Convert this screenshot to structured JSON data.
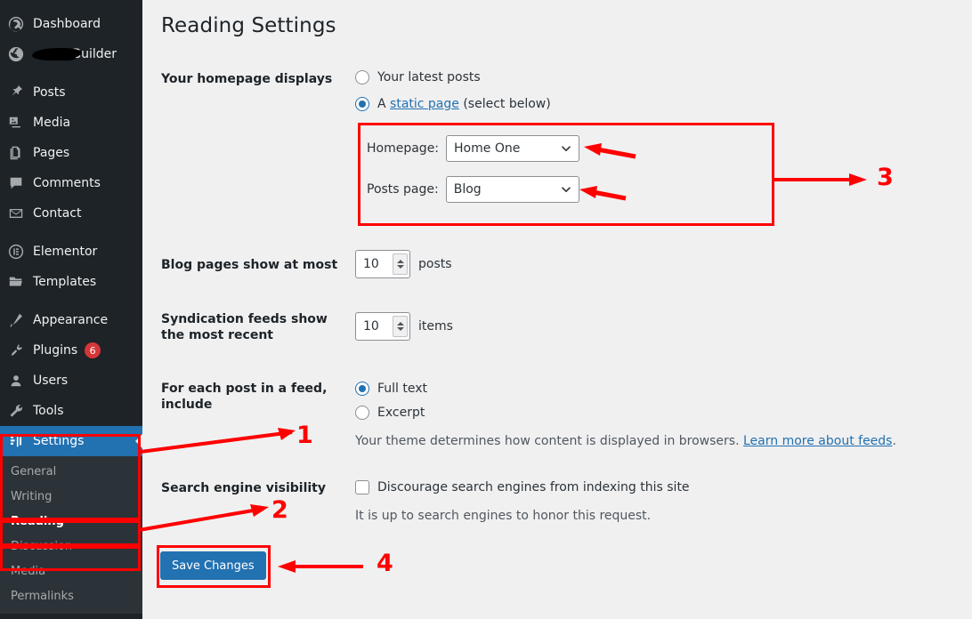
{
  "sidebar": {
    "items": [
      {
        "label": "Dashboard",
        "icon": "dashboard-icon",
        "badge": null,
        "redacted": false
      },
      {
        "label": "u Builder",
        "icon": "globe-icon",
        "badge": null,
        "redacted": true
      },
      {
        "label": "Posts",
        "icon": "pin-icon",
        "badge": null,
        "redacted": false
      },
      {
        "label": "Media",
        "icon": "media-icon",
        "badge": null,
        "redacted": false
      },
      {
        "label": "Pages",
        "icon": "pages-icon",
        "badge": null,
        "redacted": false
      },
      {
        "label": "Comments",
        "icon": "comments-icon",
        "badge": null,
        "redacted": false
      },
      {
        "label": "Contact",
        "icon": "envelope-icon",
        "badge": null,
        "redacted": false
      },
      {
        "label": "Elementor",
        "icon": "elementor-icon",
        "badge": null,
        "redacted": false
      },
      {
        "label": "Templates",
        "icon": "folder-icon",
        "badge": null,
        "redacted": false
      },
      {
        "label": "Appearance",
        "icon": "brush-icon",
        "badge": null,
        "redacted": false
      },
      {
        "label": "Plugins",
        "icon": "plug-icon",
        "badge": "6",
        "redacted": false
      },
      {
        "label": "Users",
        "icon": "user-icon",
        "badge": null,
        "redacted": false
      },
      {
        "label": "Tools",
        "icon": "wrench-icon",
        "badge": null,
        "redacted": false
      },
      {
        "label": "Settings",
        "icon": "settings-icon",
        "badge": null,
        "redacted": false
      }
    ],
    "settings_submenu": [
      {
        "label": "General",
        "current": false
      },
      {
        "label": "Writing",
        "current": false
      },
      {
        "label": "Reading",
        "current": true
      },
      {
        "label": "Discussion",
        "current": false
      },
      {
        "label": "Media",
        "current": false
      },
      {
        "label": "Permalinks",
        "current": false
      }
    ],
    "current_item": "Settings",
    "accent_blue": "#2271b1",
    "bg": "#1d2327",
    "submenu_bg": "#2c3338",
    "badge_color": "#d63638"
  },
  "page": {
    "title": "Reading Settings"
  },
  "homepage_displays": {
    "label": "Your homepage displays",
    "options": [
      {
        "text": "Your latest posts",
        "selected": false
      },
      {
        "text_prefix": "A ",
        "link_text": "static page",
        "text_suffix": " (select below)",
        "selected": true
      }
    ]
  },
  "static_page_box": {
    "homepage": {
      "label": "Homepage:",
      "value": "Home One"
    },
    "posts_page": {
      "label": "Posts page:",
      "value": "Blog"
    }
  },
  "blog_pages": {
    "label": "Blog pages show at most",
    "value": "10",
    "unit": "posts"
  },
  "syndication_feeds": {
    "label": "Syndication feeds show the most recent",
    "value": "10",
    "unit": "items"
  },
  "feed_include": {
    "label": "For each post in a feed, include",
    "options": [
      {
        "text": "Full text",
        "selected": true
      },
      {
        "text": "Excerpt",
        "selected": false
      }
    ],
    "help_prefix": "Your theme determines how content is displayed in browsers. ",
    "help_link": "Learn more about feeds",
    "help_suffix": "."
  },
  "search_visibility": {
    "label": "Search engine visibility",
    "checkbox_label": "Discourage search engines from indexing this site",
    "checked": false,
    "help": "It is up to search engines to honor this request."
  },
  "save": {
    "label": "Save Changes"
  },
  "annotations": {
    "color": "#ff0000",
    "markers": [
      {
        "number": "1",
        "target": "settings-menu-item"
      },
      {
        "number": "2",
        "target": "reading-submenu-item"
      },
      {
        "number": "3",
        "target": "static-page-selects-box"
      },
      {
        "number": "4",
        "target": "save-changes-button"
      }
    ]
  }
}
